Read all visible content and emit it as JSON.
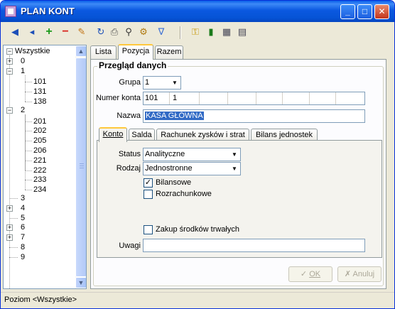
{
  "window": {
    "title": "PLAN KONT"
  },
  "toolbar": {
    "icons": [
      "first-record",
      "prev-record",
      "add-record",
      "delete-record",
      "edit-record",
      "refresh",
      "print",
      "find",
      "settings",
      "filter",
      "key",
      "chart",
      "calculator",
      "grid"
    ]
  },
  "tree": {
    "root": "Wszystkie",
    "items": [
      {
        "label": "0",
        "level": 1,
        "expander": "+"
      },
      {
        "label": "1",
        "level": 1,
        "expander": "-"
      },
      {
        "label": "101",
        "level": 2
      },
      {
        "label": "131",
        "level": 2
      },
      {
        "label": "138",
        "level": 2
      },
      {
        "label": "2",
        "level": 1,
        "expander": "-"
      },
      {
        "label": "201",
        "level": 2
      },
      {
        "label": "202",
        "level": 2
      },
      {
        "label": "205",
        "level": 2
      },
      {
        "label": "206",
        "level": 2
      },
      {
        "label": "221",
        "level": 2
      },
      {
        "label": "222",
        "level": 2
      },
      {
        "label": "233",
        "level": 2
      },
      {
        "label": "234",
        "level": 2
      },
      {
        "label": "3",
        "level": 1
      },
      {
        "label": "4",
        "level": 1,
        "expander": "+"
      },
      {
        "label": "5",
        "level": 1
      },
      {
        "label": "6",
        "level": 1,
        "expander": "+"
      },
      {
        "label": "7",
        "level": 1,
        "expander": "+"
      },
      {
        "label": "8",
        "level": 1
      },
      {
        "label": "9",
        "level": 1
      }
    ]
  },
  "tabs": {
    "lista": "Lista",
    "pozycja": "Pozycja",
    "razem": "Razem"
  },
  "group": {
    "title": "Przegląd danych",
    "grupa_label": "Grupa",
    "grupa_value": "1",
    "numer_label": "Numer konta",
    "numer_part1": "101",
    "numer_part2": "1",
    "nazwa_label": "Nazwa",
    "nazwa_value": "KASA GŁÓWNA"
  },
  "inner_tabs": {
    "konto": "Konto",
    "salda": "Salda",
    "rachunek": "Rachunek zysków i strat",
    "bilans": "Bilans jednostek"
  },
  "konto": {
    "status_label": "Status",
    "status_value": "Analityczne",
    "rodzaj_label": "Rodzaj",
    "rodzaj_value": "Jednostronne",
    "bilansowe_label": "Bilansowe",
    "bilansowe_checked": true,
    "rozrachunkowe_label": "Rozrachunkowe",
    "rozrachunkowe_checked": false,
    "zakup_label": "Zakup środków trwałych",
    "zakup_checked": false,
    "uwagi_label": "Uwagi",
    "uwagi_value": ""
  },
  "buttons": {
    "ok": "OK",
    "anuluj": "Anuluj"
  },
  "status": {
    "text": "Poziom <Wszystkie>"
  }
}
